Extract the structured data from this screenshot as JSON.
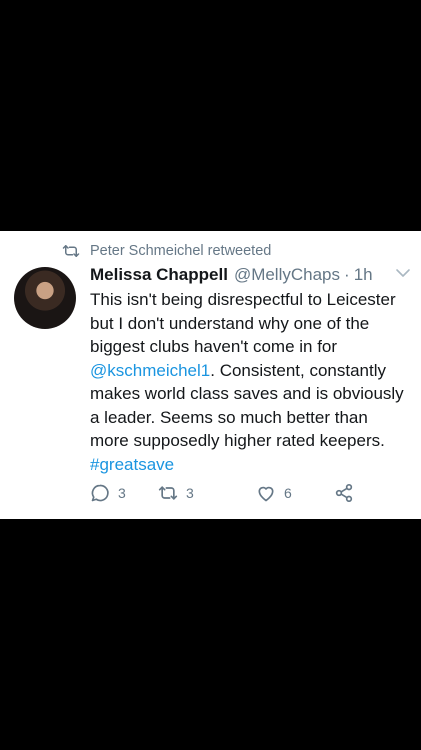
{
  "retweet_context": {
    "text": "Peter Schmeichel retweeted"
  },
  "tweet": {
    "author_name": "Melissa Chappell",
    "author_handle": "@MellyChaps",
    "separator": "·",
    "time": "1h",
    "text_before_mention": "This isn't being disrespectful to Leicester but I don't understand why one of the biggest clubs haven't come in for ",
    "mention": "@kschmeichel1",
    "text_after_mention": ". Consistent, constantly makes world class saves and is obviously a leader. Seems so much better than more supposedly higher rated keepers. ",
    "hashtag": "#greatsave"
  },
  "actions": {
    "reply_count": "3",
    "retweet_count": "3",
    "like_count": "6"
  },
  "colors": {
    "background": "#000000",
    "card": "#ffffff",
    "text": "#14171a",
    "secondary": "#657786",
    "link": "#1b95e0"
  },
  "icons": [
    "retweet-icon",
    "chevron-down-icon",
    "reply-icon",
    "retweet-action-icon",
    "heart-icon",
    "share-icon"
  ]
}
